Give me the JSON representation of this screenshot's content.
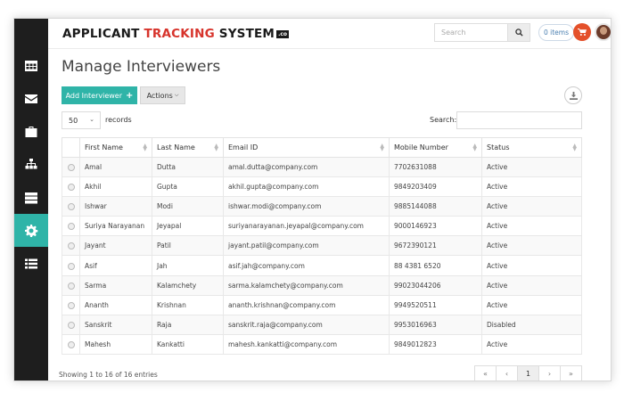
{
  "app": {
    "logo_part1": "APPLICANT ",
    "logo_part2": "TRACKING",
    "logo_part3": " SYSTEM",
    "logo_badge": ".co",
    "search_placeholder": "Search",
    "items_label": "0 items"
  },
  "sidebar": {
    "items": [
      {
        "icon": "table-icon"
      },
      {
        "icon": "envelope-icon"
      },
      {
        "icon": "briefcase-icon"
      },
      {
        "icon": "sitemap-icon"
      },
      {
        "icon": "server-icon"
      },
      {
        "icon": "gear-icon",
        "active": true
      },
      {
        "icon": "list-icon"
      }
    ]
  },
  "page": {
    "title": "Manage Interviewers",
    "add_button": "Add Interviewer",
    "actions_button": "Actions",
    "page_length": "50",
    "records_label": "records",
    "search_label": "Search:"
  },
  "table": {
    "headers": [
      "First Name",
      "Last Name",
      "Email ID",
      "Mobile Number",
      "Status"
    ],
    "rows": [
      [
        "Amal",
        "Dutta",
        "amal.dutta@company.com",
        "7702631088",
        "Active"
      ],
      [
        "Akhil",
        "Gupta",
        "akhil.gupta@company.com",
        "9849203409",
        "Active"
      ],
      [
        "Ishwar",
        "Modi",
        "ishwar.modi@company.com",
        "9885144088",
        "Active"
      ],
      [
        "Suriya Narayanan",
        "Jeyapal",
        "suriyanarayanan.jeyapal@company.com",
        "9000146923",
        "Active"
      ],
      [
        "Jayant",
        "Patil",
        "jayant.patil@company.com",
        "9672390121",
        "Active"
      ],
      [
        "Asif",
        "Jah",
        "asif.jah@company.com",
        "88 4381 6520",
        "Active"
      ],
      [
        "Sarma",
        "Kalamchety",
        "sarma.kalamchety@company.com",
        "99023044206",
        "Active"
      ],
      [
        "Ananth",
        "Krishnan",
        "ananth.krishnan@company.com",
        "9949520511",
        "Active"
      ],
      [
        "Sanskrit",
        "Raja",
        "sanskrit.raja@company.com",
        "9953016963",
        "Disabled"
      ],
      [
        "Mahesh",
        "Kankatti",
        "mahesh.kankatti@company.com",
        "9849012823",
        "Active"
      ]
    ]
  },
  "footer": {
    "info": "Showing 1 to 16 of 16 entries",
    "pager": [
      "«",
      "‹",
      "1",
      "›",
      "»"
    ],
    "current_page": "1"
  },
  "colors": {
    "accent": "#2fb4a8",
    "sidebar_bg": "#1e1e1e",
    "brand_red": "#d7342c",
    "cart": "#e4502a"
  }
}
